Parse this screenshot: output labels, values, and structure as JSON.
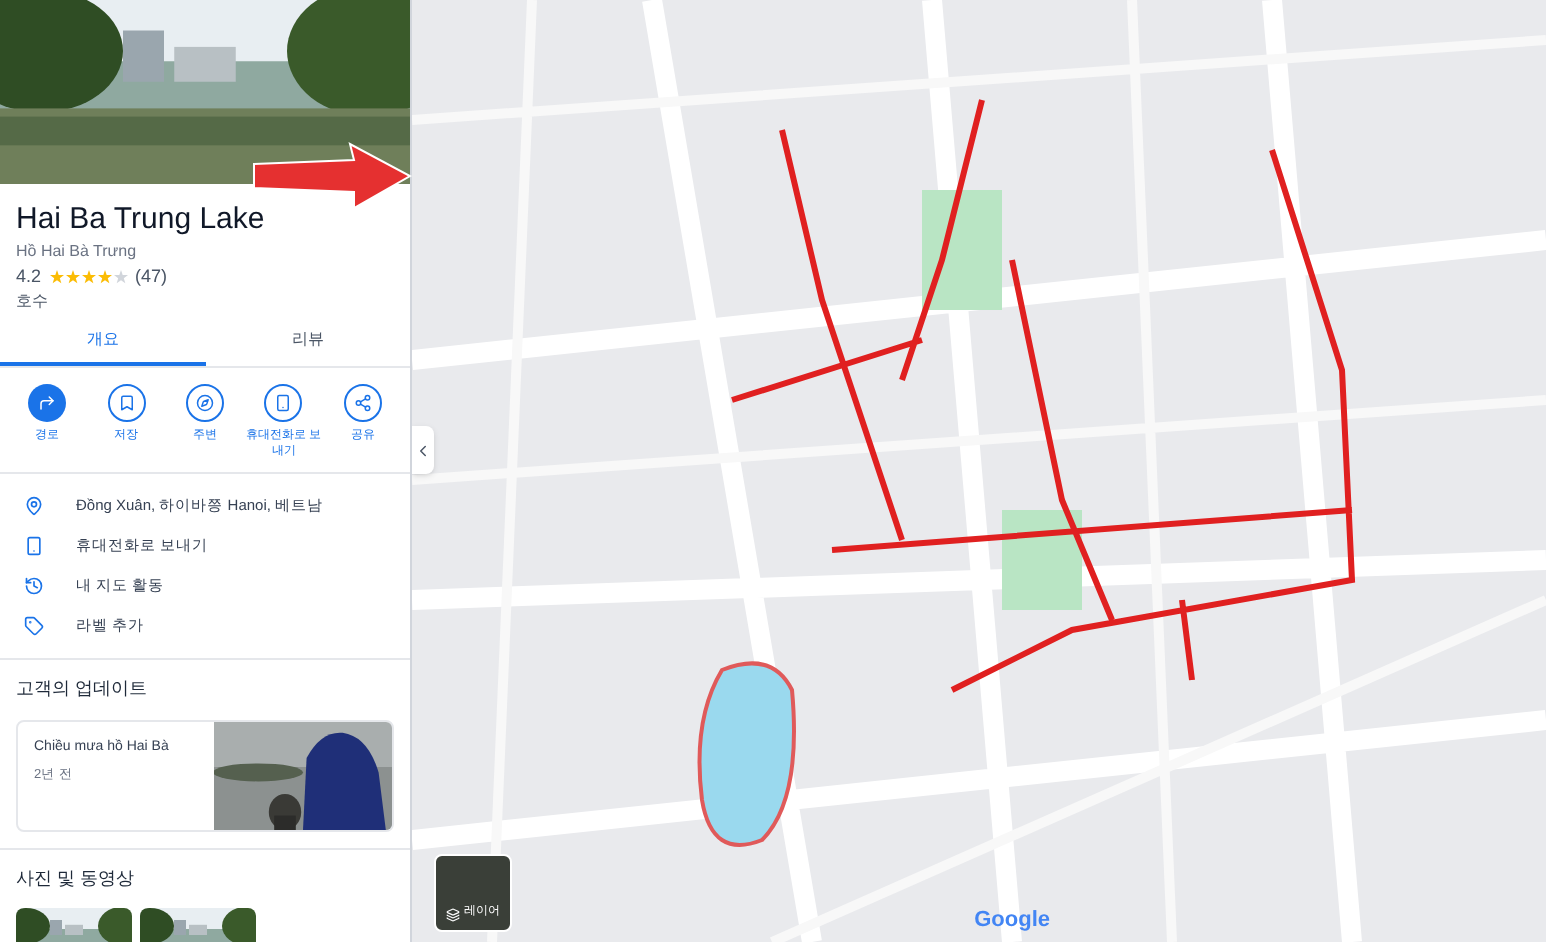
{
  "place": {
    "title": "Hai Ba Trung Lake",
    "subtitle": "Hồ Hai Bà Trưng",
    "rating": "4.2",
    "stars": 4,
    "review_count": "(47)",
    "category": "호수"
  },
  "tabs": [
    {
      "label": "개요",
      "selected": true
    },
    {
      "label": "리뷰",
      "selected": false
    }
  ],
  "actions": [
    {
      "kind": "directions",
      "label": "경로"
    },
    {
      "kind": "save",
      "label": "저장"
    },
    {
      "kind": "nearby",
      "label": "주변"
    },
    {
      "kind": "phone",
      "label": "휴대전화로 보내기"
    },
    {
      "kind": "share",
      "label": "공유"
    }
  ],
  "details": [
    {
      "kind": "location",
      "text": "Đồng Xuân, 하이바쯩 Hanoi, 베트남"
    },
    {
      "kind": "phone",
      "text": "휴대전화로 보내기"
    },
    {
      "kind": "history",
      "text": "내 지도 활동"
    },
    {
      "kind": "label",
      "text": "라벨 추가"
    }
  ],
  "updates": {
    "heading": "고객의 업데이트",
    "card": {
      "title": "Chiều mưa hồ Hai Bà",
      "time": "2년 전"
    }
  },
  "photos": {
    "heading": "사진 및 동영상"
  },
  "map": {
    "layers_label": "레이어",
    "logo": "Google"
  }
}
